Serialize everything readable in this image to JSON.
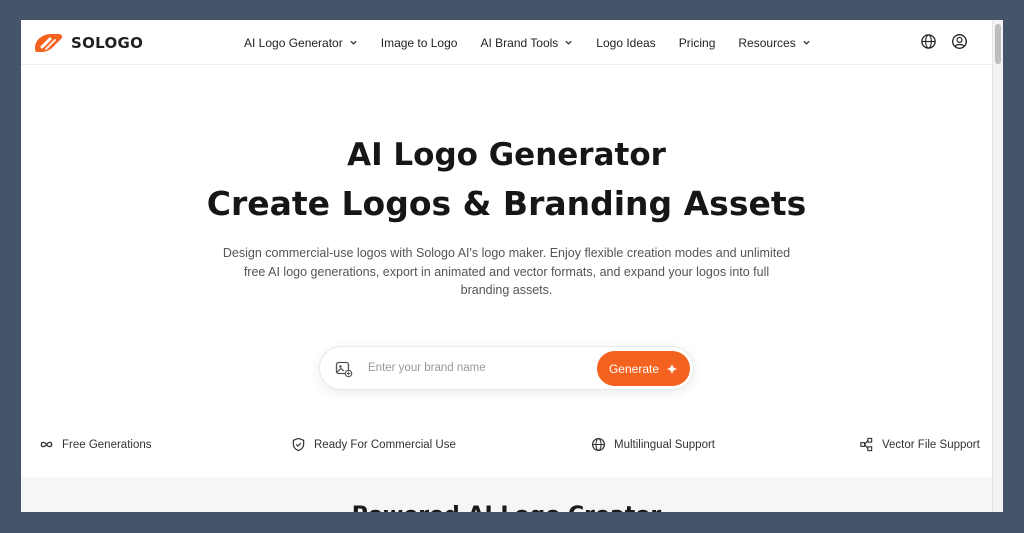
{
  "brand": {
    "name": "SOLOGO",
    "accent": "#f4621f"
  },
  "nav": {
    "items": [
      {
        "label": "AI Logo Generator",
        "dropdown": true
      },
      {
        "label": "Image to Logo",
        "dropdown": false
      },
      {
        "label": "AI Brand Tools",
        "dropdown": true
      },
      {
        "label": "Logo Ideas",
        "dropdown": false
      },
      {
        "label": "Pricing",
        "dropdown": false
      },
      {
        "label": "Resources",
        "dropdown": true
      }
    ],
    "right_icons": [
      "globe-icon",
      "user-icon"
    ]
  },
  "hero": {
    "title_line1": "AI Logo Generator",
    "title_line2": "Create Logos & Branding Assets",
    "description": "Design commercial-use logos with Sologo AI's logo maker. Enjoy flexible creation modes and unlimited free AI logo generations, export in animated and vector formats, and expand your logos into full branding assets."
  },
  "search": {
    "placeholder": "Enter your brand name",
    "value": "",
    "button_label": "Generate"
  },
  "features": [
    {
      "icon": "infinity-icon",
      "label": "Free Generations"
    },
    {
      "icon": "shield-check-icon",
      "label": "Ready For Commercial Use"
    },
    {
      "icon": "globe-icon",
      "label": "Multilingual Support"
    },
    {
      "icon": "vector-nodes-icon",
      "label": "Vector File Support"
    }
  ],
  "next_section": {
    "heading": "Powered AI Logo Creator"
  }
}
